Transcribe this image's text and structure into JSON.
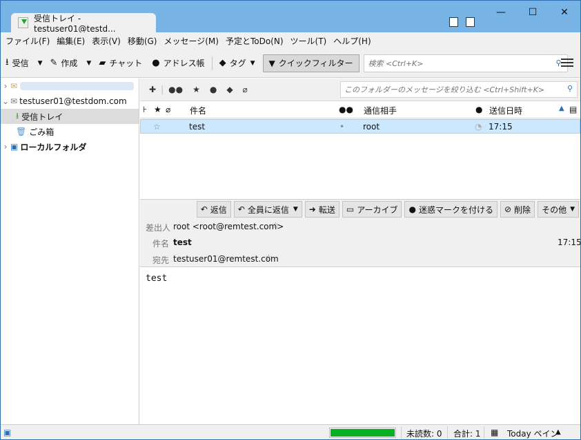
{
  "window": {
    "tab_title": "受信トレイ - testuser01@testd...",
    "controls": {
      "minimize": "—",
      "maximize": "☐",
      "close": "✕"
    }
  },
  "menu": [
    "ファイル(F)",
    "編集(E)",
    "表示(V)",
    "移動(G)",
    "メッセージ(M)",
    "予定とToDo(N)",
    "ツール(T)",
    "ヘルプ(H)"
  ],
  "toolbar": {
    "receive": "受信",
    "compose": "作成",
    "chat": "チャット",
    "addressbook": "アドレス帳",
    "tag": "タグ",
    "quickfilter": "クイックフィルター",
    "search_placeholder": "検索 <Ctrl+K>"
  },
  "sidebar": {
    "account1": "testuser01@testdom.com",
    "inbox": "受信トレイ",
    "trash": "ごみ箱",
    "local": "ローカルフォルダ"
  },
  "quickfilter": {
    "search_placeholder": "このフォルダーのメッセージを絞り込む <Ctrl+Shift+K>"
  },
  "columns": {
    "subject": "件名",
    "correspondent": "通信相手",
    "date": "送信日時"
  },
  "messages": [
    {
      "subject": "test",
      "correspondent": "root",
      "date": "17:15"
    }
  ],
  "msg_actions": {
    "reply": "返信",
    "reply_all": "全員に返信",
    "forward": "転送",
    "archive": "アーカイブ",
    "junk": "迷惑マークを付ける",
    "delete": "削除",
    "other": "その他"
  },
  "header": {
    "from_label": "差出人",
    "from": "root <root@remtest.com>",
    "subject_label": "件名",
    "subject": "test",
    "date": "17:15",
    "to_label": "宛先",
    "to": "testuser01@remtest.com"
  },
  "body": "test",
  "status": {
    "unread": "未読数: 0",
    "total": "合計: 1",
    "today": "Today ペイン",
    "progress_percent": 100
  },
  "colors": {
    "titlebar": "#77b3e5",
    "selection": "#cce8ff",
    "progress": "#06b025"
  }
}
